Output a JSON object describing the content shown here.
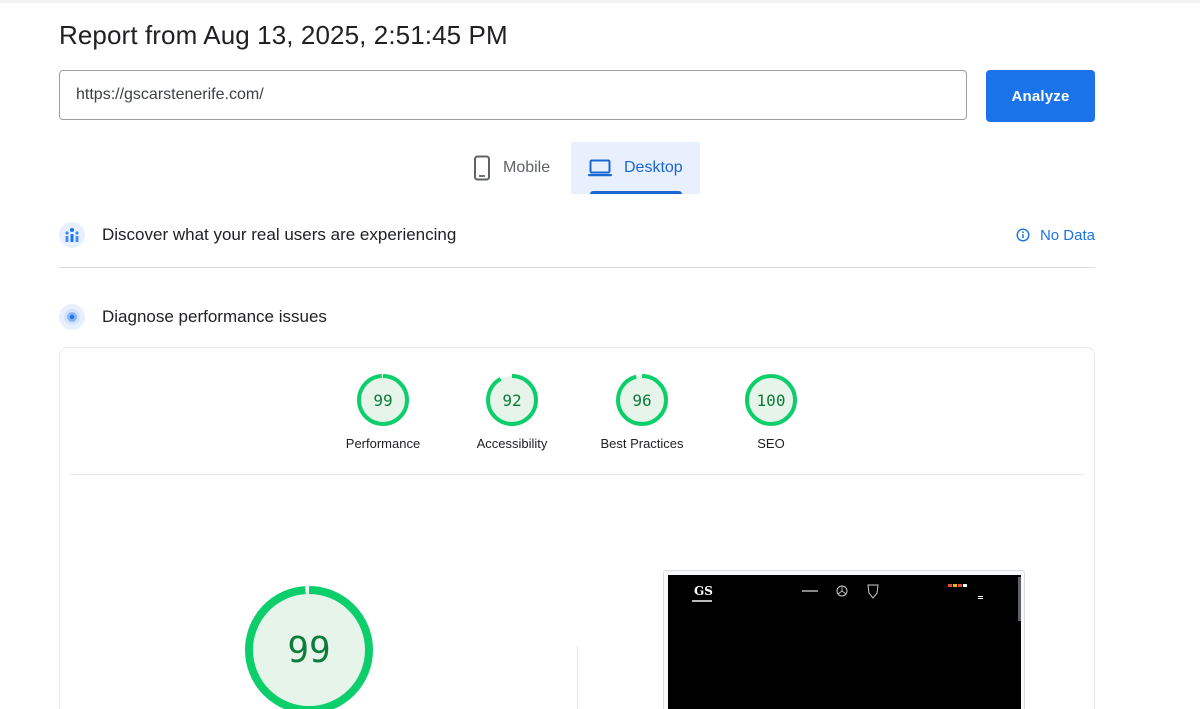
{
  "report": {
    "title": "Report from Aug 13, 2025, 2:51:45 PM"
  },
  "url_input": {
    "value": "https://gscarstenerife.com/"
  },
  "analyze_button": {
    "label": "Analyze"
  },
  "device_tabs": [
    {
      "label": "Mobile",
      "icon": "smartphone-icon",
      "selected": false
    },
    {
      "label": "Desktop",
      "icon": "laptop-icon",
      "selected": true
    }
  ],
  "field_data": {
    "title": "Discover what your real users are experiencing",
    "status": "No Data",
    "icon": "users-chart-icon",
    "status_icon": "info-icon"
  },
  "lab_data": {
    "title": "Diagnose performance issues",
    "icon": "target-icon"
  },
  "scores": [
    {
      "label": "Performance",
      "value": 99
    },
    {
      "label": "Accessibility",
      "value": 92
    },
    {
      "label": "Best Practices",
      "value": 96
    },
    {
      "label": "SEO",
      "value": 100
    }
  ],
  "main_score": {
    "value": "99"
  },
  "colors": {
    "accent": "#1a73e8",
    "pass": "#0cce6b",
    "pass_text": "#0c7c3a",
    "pass_fill": "#e6f4ea"
  }
}
